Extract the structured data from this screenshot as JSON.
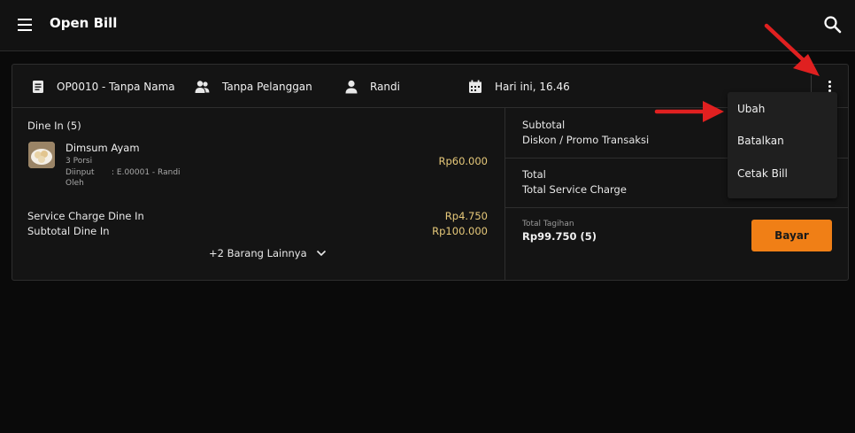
{
  "header": {
    "title": "Open Bill"
  },
  "info": {
    "order": "OP0010 - Tanpa Nama",
    "customer": "Tanpa Pelanggan",
    "staff": "Randi",
    "time": "Hari ini, 16.46"
  },
  "dine_in": {
    "heading": "Dine In (5)",
    "item": {
      "name": "Dimsum Ayam",
      "qty": "3 Porsi",
      "input_label_1": "Diinput",
      "input_label_2": "Oleh",
      "input_value": ":  E.00001 - Randi",
      "price": "Rp60.000"
    },
    "service_charge_label": "Service Charge Dine In",
    "service_charge_value": "Rp4.750",
    "subtotal_label": "Subtotal Dine In",
    "subtotal_value": "Rp100.000",
    "more_label": "+2 Barang Lainnya"
  },
  "summary": {
    "subtotal_label": "Subtotal",
    "discount_label": "Diskon / Promo Transaksi",
    "total_label": "Total",
    "service_total_label": "Total Service Charge",
    "total_bill_label": "Total Tagihan",
    "total_bill_value": "Rp99.750 (5)",
    "pay_label": "Bayar"
  },
  "menu": {
    "items": [
      {
        "label": "Ubah"
      },
      {
        "label": "Batalkan"
      },
      {
        "label": "Cetak Bill"
      }
    ]
  },
  "colors": {
    "accent": "#f07f16",
    "price": "#e7c97a",
    "annotation": "#e02020"
  }
}
